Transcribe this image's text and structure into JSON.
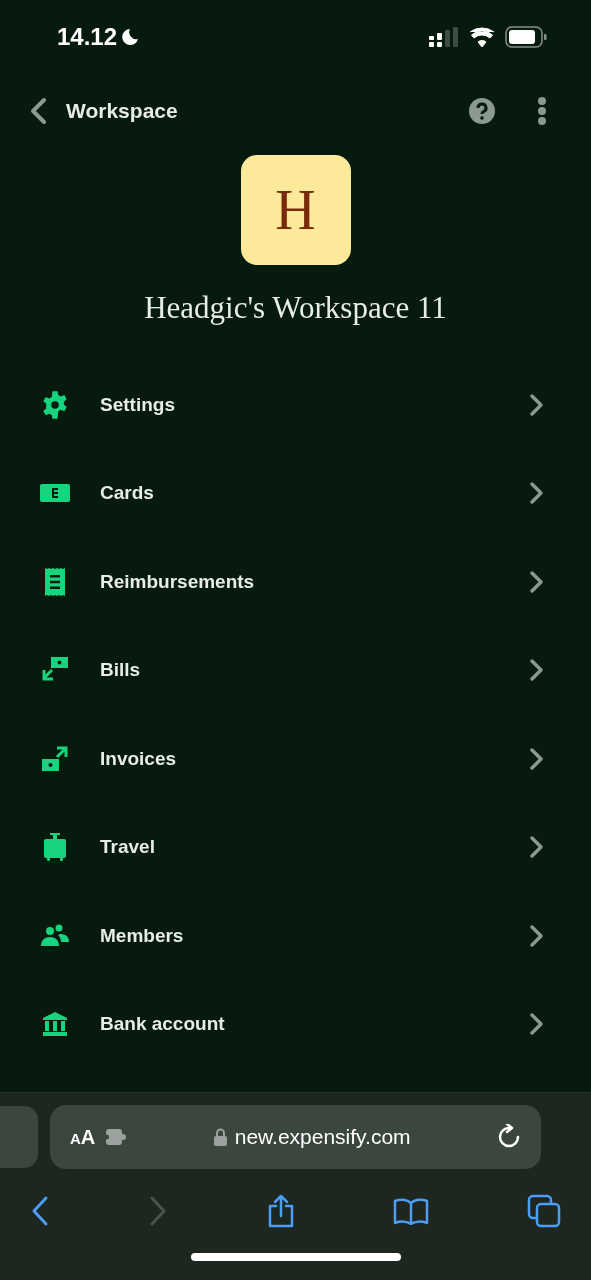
{
  "status_bar": {
    "time": "14.12"
  },
  "header": {
    "title": "Workspace"
  },
  "workspace": {
    "avatar_letter": "H",
    "name": "Headgic's Workspace 11"
  },
  "menu": [
    {
      "kind": "settings",
      "label": "Settings"
    },
    {
      "kind": "cards",
      "label": "Cards"
    },
    {
      "kind": "reimbursements",
      "label": "Reimbursements"
    },
    {
      "kind": "bills",
      "label": "Bills"
    },
    {
      "kind": "invoices",
      "label": "Invoices"
    },
    {
      "kind": "travel",
      "label": "Travel"
    },
    {
      "kind": "members",
      "label": "Members"
    },
    {
      "kind": "bank",
      "label": "Bank account"
    }
  ],
  "browser": {
    "text_size_button": "AA",
    "url": "new.expensify.com",
    "toolbar": [
      {
        "kind": "back",
        "disabled": false
      },
      {
        "kind": "forward",
        "disabled": true
      },
      {
        "kind": "share",
        "disabled": false
      },
      {
        "kind": "bookmarks",
        "disabled": false
      },
      {
        "kind": "tabs",
        "disabled": false
      }
    ]
  }
}
